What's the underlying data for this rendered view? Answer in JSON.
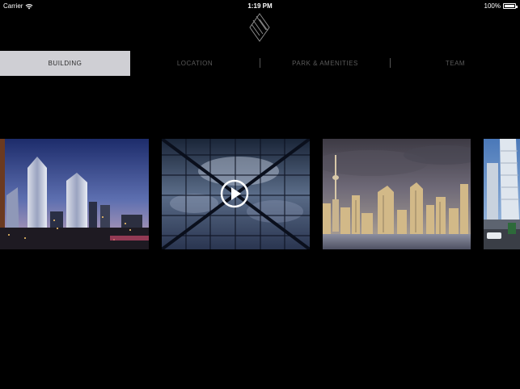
{
  "status_bar": {
    "carrier": "Carrier",
    "wifi_icon": "wifi-icon",
    "time": "1:19 PM",
    "battery_percent": "100%",
    "battery_icon": "battery-icon"
  },
  "logo": {
    "icon": "diamond-logo-icon"
  },
  "nav": {
    "tabs": [
      {
        "label": "BUILDING",
        "active": true
      },
      {
        "label": "LOCATION",
        "active": false
      },
      {
        "label": "PARK & AMENITIES",
        "active": false
      },
      {
        "label": "TEAM",
        "active": false
      }
    ]
  },
  "gallery": {
    "items": [
      {
        "kind": "image",
        "subject": "twin-towers-dusk"
      },
      {
        "kind": "video",
        "subject": "glass-facade-sky",
        "icon": "play-icon"
      },
      {
        "kind": "image",
        "subject": "city-skyline-waterfront"
      },
      {
        "kind": "image",
        "subject": "towers-street-view"
      }
    ]
  },
  "colors": {
    "background": "#000000",
    "tab_active_bg": "#cfcfd4",
    "tab_active_text": "#2b2b2b",
    "tab_inactive_text": "#5a5a5a"
  }
}
